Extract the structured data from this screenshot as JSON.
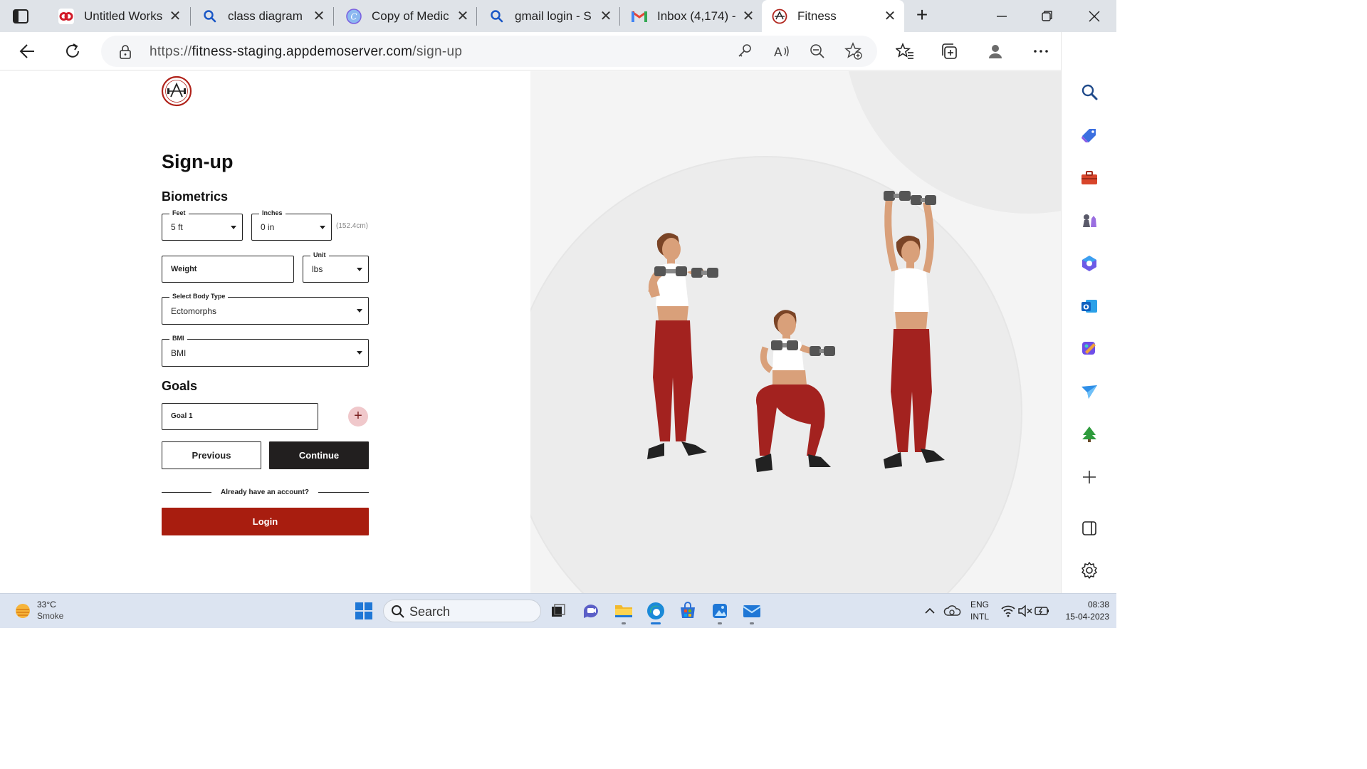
{
  "browser": {
    "tabs": [
      {
        "title": "Untitled Works",
        "favicon": "infinity-logo-icon"
      },
      {
        "title": "class diagram c",
        "favicon": "search-icon"
      },
      {
        "title": "Copy of Medic",
        "favicon": "canva-icon"
      },
      {
        "title": "gmail login - S",
        "favicon": "search-icon"
      },
      {
        "title": "Inbox (4,174) -",
        "favicon": "gmail-icon"
      },
      {
        "title": "Fitness",
        "favicon": "fitness-logo-icon",
        "active": true
      }
    ],
    "url_prefix": "https://",
    "url_host": "fitness-staging.appdemoserver.com",
    "url_path": "/sign-up"
  },
  "form": {
    "title": "Sign-up",
    "biometrics_heading": "Biometrics",
    "feet": {
      "legend": "Feet",
      "value": "5 ft"
    },
    "inches": {
      "legend": "Inches",
      "value": "0 in"
    },
    "height_hint": "(152.4cm)",
    "weight": {
      "placeholder": "Weight"
    },
    "unit": {
      "legend": "Unit",
      "value": "lbs"
    },
    "body_type": {
      "legend": "Select Body Type",
      "value": "Ectomorphs"
    },
    "bmi": {
      "legend": "BMI",
      "value": "BMI"
    },
    "goals_heading": "Goals",
    "goal1": {
      "placeholder": "Goal 1"
    },
    "add_goal": "+",
    "previous_label": "Previous",
    "continue_label": "Continue",
    "account_prompt": "Already have an account?",
    "login_label": "Login"
  },
  "taskbar": {
    "weather_temp": "33°C",
    "weather_desc": "Smoke",
    "search_label": "Search",
    "lang_top": "ENG",
    "lang_bottom": "INTL",
    "time": "08:38",
    "date": "15-04-2023"
  },
  "colors": {
    "accent_red": "#a81d0f",
    "button_dark": "#221f1f",
    "add_button_bg": "#f0c8cb",
    "hero_bg": "#f4f4f4",
    "legging_red": "#a3221f"
  }
}
